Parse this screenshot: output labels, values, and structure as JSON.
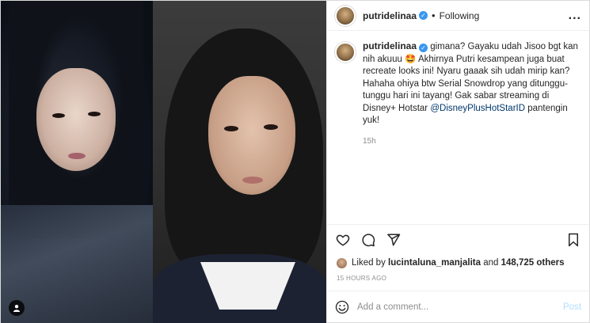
{
  "header": {
    "username": "putridelinaa",
    "dot": "•",
    "follow_status": "Following",
    "more": "..."
  },
  "caption": {
    "username": "putridelinaa",
    "text_before_mention": "gimana? Gayaku udah Jisoo bgt kan nih akuuu 🤩 Akhirnya Putri kesampean juga buat recreate looks ini! Nyaru gaaak sih udah mirip kan? Hahaha ohiya btw Serial Snowdrop yang ditunggu-tunggu hari ini tayang! Gak sabar streaming di Disney+ Hotstar",
    "mention": "@DisneyPlusHotStarID",
    "text_after_mention": "pantengin yuk!",
    "age": "15h"
  },
  "actions": {
    "like_icon": "heart-icon",
    "comment_icon": "comment-icon",
    "share_icon": "share-icon",
    "save_icon": "bookmark-icon"
  },
  "likes": {
    "prefix": "Liked by",
    "liker": "lucintaluna_manjalita",
    "and": "and",
    "count": "148,725 others"
  },
  "timestamp": "15 HOURS AGO",
  "add_comment": {
    "placeholder": "Add a comment...",
    "post_label": "Post",
    "emoji_icon": "emoji-icon"
  },
  "colors": {
    "verified": "#3897f0",
    "mention": "#00376b",
    "post_disabled": "#b2dffc",
    "secondary_text": "#8e8e8e"
  }
}
